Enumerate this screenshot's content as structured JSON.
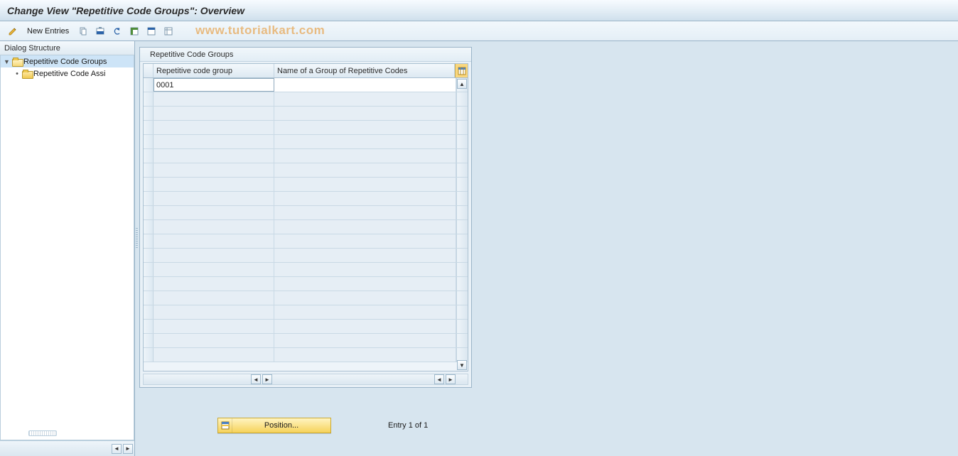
{
  "title": "Change View \"Repetitive Code Groups\": Overview",
  "toolbar": {
    "new_entries_label": "New Entries"
  },
  "watermark": "www.tutorialkart.com",
  "sidebar": {
    "header": "Dialog Structure",
    "items": [
      {
        "label": "Repetitive Code Groups",
        "selected": true,
        "level": 0,
        "open": true,
        "expander": "▼"
      },
      {
        "label": "Repetitive Code Assi",
        "selected": false,
        "level": 1,
        "open": false,
        "expander": "•"
      }
    ]
  },
  "table": {
    "title": "Repetitive Code Groups",
    "columns": {
      "code": "Repetitive code group",
      "name": "Name of a Group of Repetitive Codes"
    },
    "rows": [
      {
        "code": "0001",
        "name": ""
      }
    ],
    "empty_row_count": 19
  },
  "footer": {
    "position_label": "Position...",
    "status": "Entry 1 of 1"
  }
}
